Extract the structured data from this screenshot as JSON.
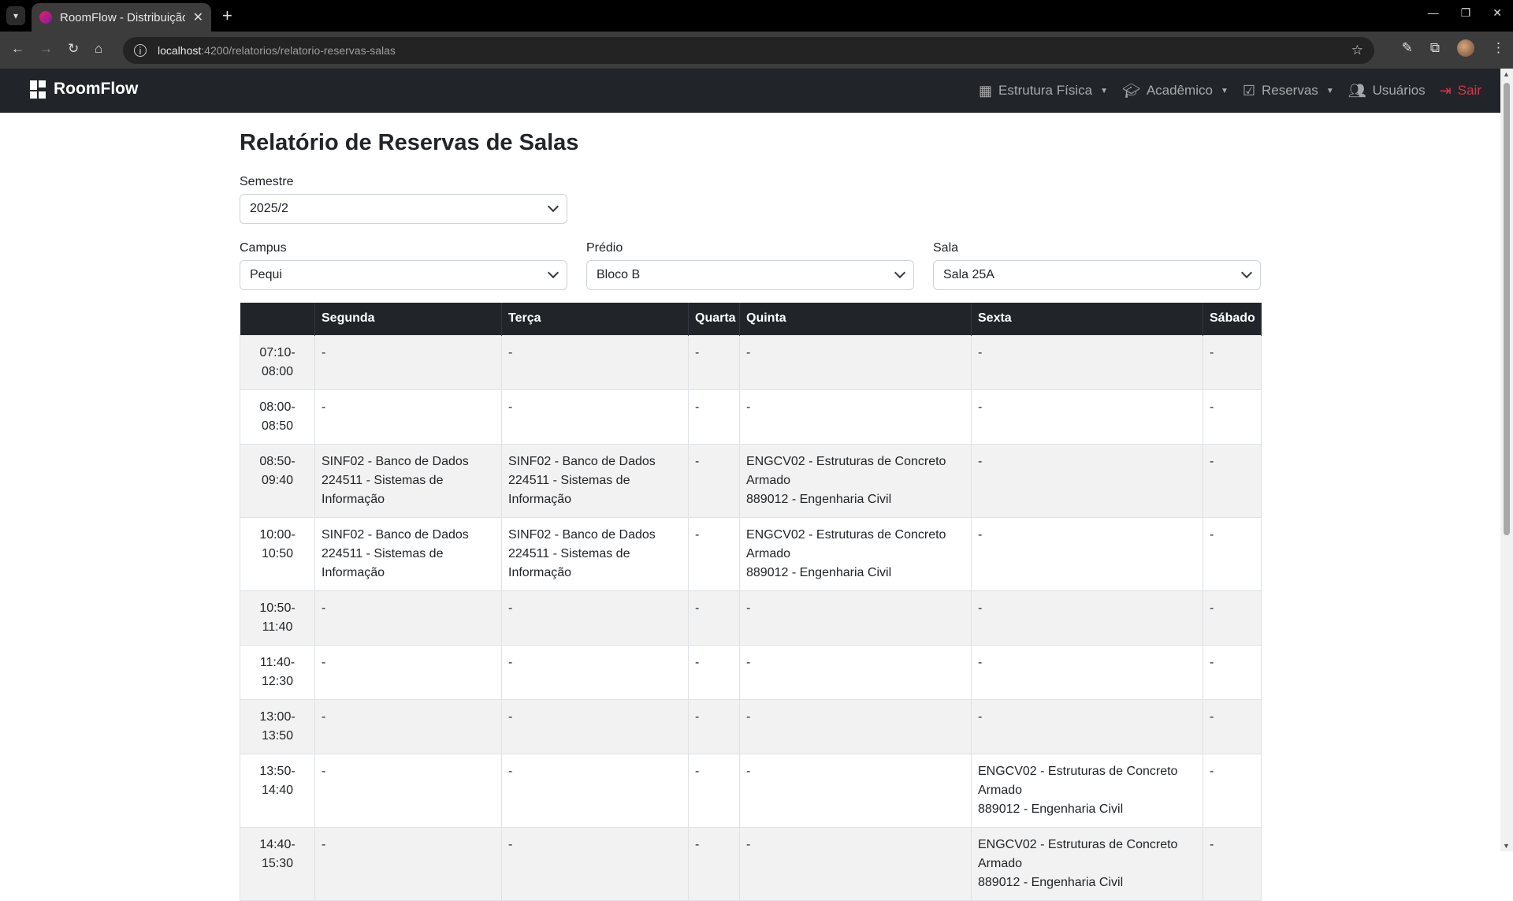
{
  "browser": {
    "tab_title": "RoomFlow - Distribuição",
    "url_host": "localhost",
    "url_path": ":4200/relatorios/relatorio-reservas-salas"
  },
  "navbar": {
    "brand": "RoomFlow",
    "items": [
      {
        "label": "Estrutura Física",
        "icon": "building-icon",
        "dropdown": true
      },
      {
        "label": "Acadêmico",
        "icon": "graduation-cap-icon",
        "dropdown": true
      },
      {
        "label": "Reservas",
        "icon": "calendar-check-icon",
        "dropdown": true
      },
      {
        "label": "Usuários",
        "icon": "users-icon",
        "dropdown": false
      },
      {
        "label": "Sair",
        "icon": "logout-icon",
        "dropdown": false
      }
    ]
  },
  "page": {
    "title": "Relatório de Reservas de Salas",
    "semestre": {
      "label": "Semestre",
      "value": "2025/2"
    },
    "campus": {
      "label": "Campus",
      "value": "Pequi"
    },
    "predio": {
      "label": "Prédio",
      "value": "Bloco B"
    },
    "sala": {
      "label": "Sala",
      "value": "Sala 25A"
    }
  },
  "table": {
    "headers": [
      "",
      "Segunda",
      "Terça",
      "Quarta",
      "Quinta",
      "Sexta",
      "Sábado"
    ],
    "rows": [
      {
        "time": [
          "07:10-",
          "08:00"
        ],
        "cells": [
          [
            "-"
          ],
          [
            "-"
          ],
          [
            "-"
          ],
          [
            "-"
          ],
          [
            "-"
          ],
          [
            "-"
          ]
        ]
      },
      {
        "time": [
          "08:00-",
          "08:50"
        ],
        "cells": [
          [
            "-"
          ],
          [
            "-"
          ],
          [
            "-"
          ],
          [
            "-"
          ],
          [
            "-"
          ],
          [
            "-"
          ]
        ]
      },
      {
        "time": [
          "08:50-",
          "09:40"
        ],
        "cells": [
          [
            "SINF02 - Banco de Dados",
            "224511 - Sistemas de Informação"
          ],
          [
            "SINF02 - Banco de Dados",
            "224511 - Sistemas de Informação"
          ],
          [
            "-"
          ],
          [
            "ENGCV02 - Estruturas de Concreto Armado",
            "889012 - Engenharia Civil"
          ],
          [
            "-"
          ],
          [
            "-"
          ]
        ]
      },
      {
        "time": [
          "10:00-",
          "10:50"
        ],
        "cells": [
          [
            "SINF02 - Banco de Dados",
            "224511 - Sistemas de Informação"
          ],
          [
            "SINF02 - Banco de Dados",
            "224511 - Sistemas de Informação"
          ],
          [
            "-"
          ],
          [
            "ENGCV02 - Estruturas de Concreto Armado",
            "889012 - Engenharia Civil"
          ],
          [
            "-"
          ],
          [
            "-"
          ]
        ]
      },
      {
        "time": [
          "10:50-",
          "11:40"
        ],
        "cells": [
          [
            "-"
          ],
          [
            "-"
          ],
          [
            "-"
          ],
          [
            "-"
          ],
          [
            "-"
          ],
          [
            "-"
          ]
        ]
      },
      {
        "time": [
          "11:40-",
          "12:30"
        ],
        "cells": [
          [
            "-"
          ],
          [
            "-"
          ],
          [
            "-"
          ],
          [
            "-"
          ],
          [
            "-"
          ],
          [
            "-"
          ]
        ]
      },
      {
        "time": [
          "13:00-",
          "13:50"
        ],
        "cells": [
          [
            "-"
          ],
          [
            "-"
          ],
          [
            "-"
          ],
          [
            "-"
          ],
          [
            "-"
          ],
          [
            "-"
          ]
        ]
      },
      {
        "time": [
          "13:50-",
          "14:40"
        ],
        "cells": [
          [
            "-"
          ],
          [
            "-"
          ],
          [
            "-"
          ],
          [
            "-"
          ],
          [
            "ENGCV02 - Estruturas de Concreto Armado",
            "889012 - Engenharia Civil"
          ],
          [
            "-"
          ]
        ]
      },
      {
        "time": [
          "14:40-",
          "15:30"
        ],
        "cells": [
          [
            "-"
          ],
          [
            "-"
          ],
          [
            "-"
          ],
          [
            "-"
          ],
          [
            "ENGCV02 - Estruturas de Concreto Armado",
            "889012 - Engenharia Civil"
          ],
          [
            "-"
          ]
        ]
      }
    ]
  }
}
